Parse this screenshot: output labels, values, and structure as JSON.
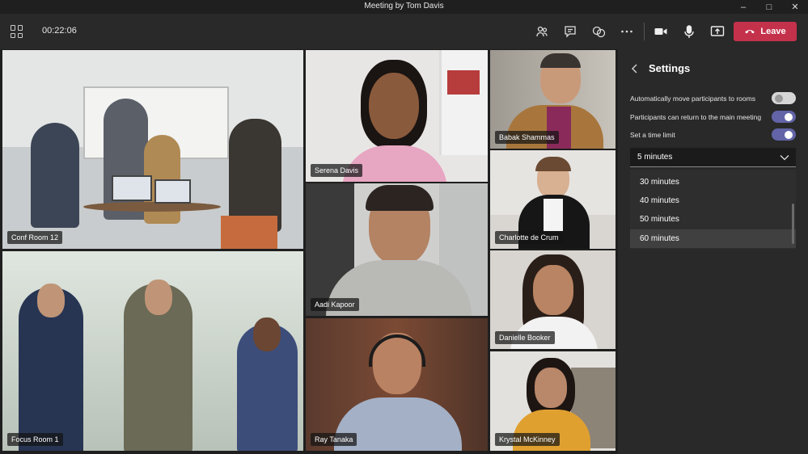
{
  "window": {
    "title": "Meeting by Tom Davis"
  },
  "toolbar": {
    "timer": "00:22:06",
    "leave_label": "Leave",
    "icons": [
      "grid-layout-icon",
      "people-icon",
      "chat-icon",
      "breakout-rooms-icon",
      "more-icon",
      "camera-icon",
      "mic-icon",
      "share-icon",
      "phone-icon"
    ]
  },
  "tiles": [
    {
      "name": "Conf Room 12"
    },
    {
      "name": "Serena Davis"
    },
    {
      "name": "Babak Shammas"
    },
    {
      "name": "Charlotte de Crum"
    },
    {
      "name": "Aadi Kapoor"
    },
    {
      "name": "Danielle Booker"
    },
    {
      "name": "Focus Room 1"
    },
    {
      "name": "Ray Tanaka"
    },
    {
      "name": "Krystal McKinney"
    }
  ],
  "settings": {
    "title": "Settings",
    "auto_move_label": "Automatically move participants to rooms",
    "auto_move_on": false,
    "return_label": "Participants can return to the main meeting",
    "return_on": true,
    "time_limit_label": "Set a time limit",
    "time_limit_on": true,
    "selected_duration": "5 minutes",
    "options": [
      "30 minutes",
      "40 minutes",
      "50 minutes",
      "60 minutes"
    ],
    "highlighted_option": "60 minutes"
  },
  "colors": {
    "leave": "#c4314b",
    "toggle_on": "#6264a7"
  }
}
